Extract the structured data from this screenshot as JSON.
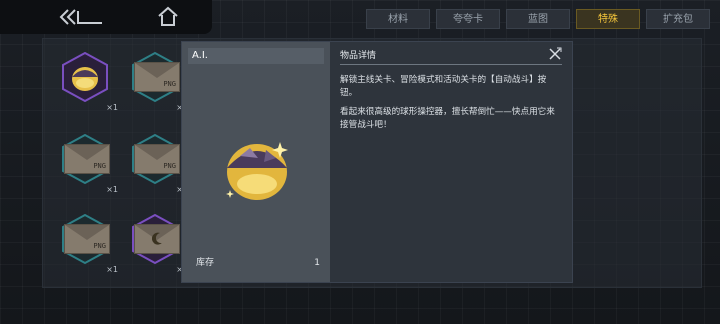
{
  "header": {
    "tabs": [
      {
        "label": "材料",
        "active": false
      },
      {
        "label": "夸夸卡",
        "active": false
      },
      {
        "label": "蓝图",
        "active": false
      },
      {
        "label": "特殊",
        "active": true
      },
      {
        "label": "扩充包",
        "active": false
      }
    ],
    "back_icon": "double-chevron-back-icon",
    "home_icon": "home-icon"
  },
  "inventory": {
    "items": [
      {
        "icon": "ai-sphere-icon",
        "qty": "×1",
        "frame": "purple"
      },
      {
        "icon": "png-envelope-icon",
        "label": "PNG",
        "qty": "×1",
        "frame": "teal"
      },
      {
        "icon": "png-envelope-icon",
        "label": "PNG",
        "qty": "×1",
        "frame": "teal"
      },
      {
        "icon": "png-envelope-icon",
        "label": "PNG",
        "qty": "×1",
        "frame": "teal"
      },
      {
        "icon": "png-envelope-icon",
        "label": "PNG",
        "qty": "×1",
        "frame": "teal"
      },
      {
        "icon": "moon-envelope-icon",
        "qty": "×1",
        "frame": "purple"
      }
    ]
  },
  "modal": {
    "item_name": "A.I.",
    "stock_label": "库存",
    "stock_value": "1",
    "detail_title": "物品详情",
    "description_1": "解锁主线关卡、冒险模式和活动关卡的【自动战斗】按钮。",
    "description_2": "看起来很高级的球形操控器，擅长帮倒忙——快点用它来接管战斗吧！",
    "close_icon": "close-icon"
  },
  "colors": {
    "accent_gold": "#f5c63a",
    "frame_purple": "#7a4fc0",
    "frame_teal": "#2e7f86"
  }
}
